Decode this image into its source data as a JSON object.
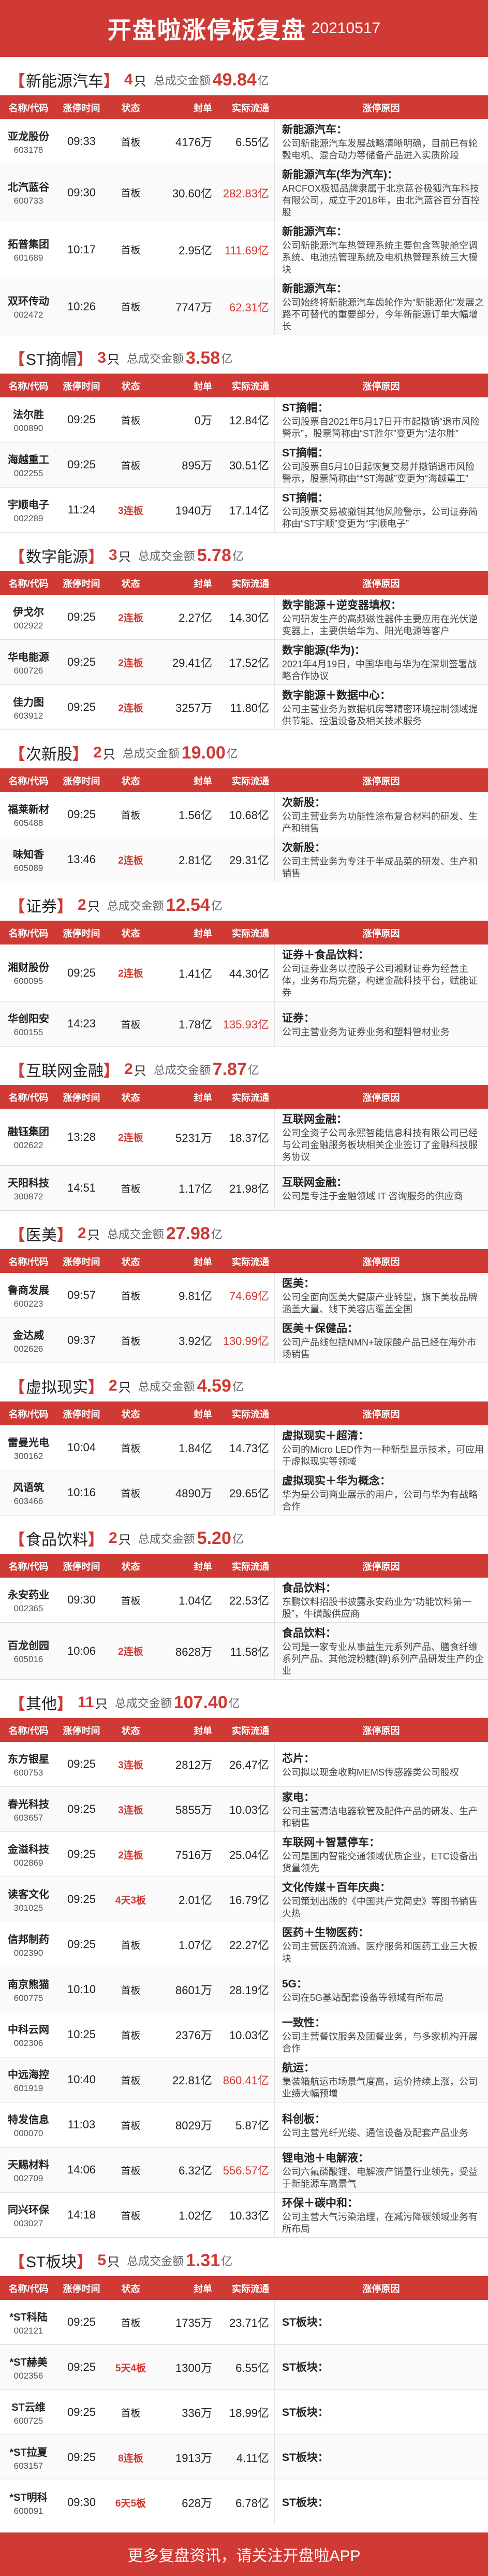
{
  "header": {
    "title": "开盘啦涨停板复盘",
    "date": "20210517"
  },
  "labels": {
    "unit": "只",
    "amount_label": "总成交金额",
    "amount_unit": "亿",
    "cols": [
      "名称/代码",
      "涨停时间",
      "状态",
      "封单",
      "实际流通",
      "涨停原因"
    ]
  },
  "sections": [
    {
      "name": "新能源汽车",
      "count": "4",
      "amount": "49.84",
      "rows": [
        {
          "name": "亚龙股份",
          "code": "603178",
          "time": "09:33",
          "status": "首板",
          "seal": "4176万",
          "turnover": "6.55亿",
          "reason_title": "新能源汽车：",
          "reason_text": "公司新能源汽车发展战略清晰明确，目前已有轮毂电机、混合动力等储备产品进入实质阶段"
        },
        {
          "name": "北汽蓝谷",
          "code": "600733",
          "time": "09:30",
          "status": "首板",
          "seal": "30.60亿",
          "turnover": "282.83亿",
          "reason_title": "新能源汽车(华为汽车)：",
          "reason_text": "ARCFOX极狐品牌隶属于北京蓝谷极狐汽车科技有限公司，成立于2018年，由北汽蓝谷百分百控股"
        },
        {
          "name": "拓普集团",
          "code": "601689",
          "time": "10:17",
          "status": "首板",
          "seal": "2.95亿",
          "turnover": "111.69亿",
          "reason_title": "新能源汽车：",
          "reason_text": "公司新能源汽车热管理系统主要包含驾驶舱空调系统、电池热管理系统及电机热管理系统三大模块"
        },
        {
          "name": "双环传动",
          "code": "002472",
          "time": "10:26",
          "status": "首板",
          "seal": "7747万",
          "turnover": "62.31亿",
          "reason_title": "新能源汽车：",
          "reason_text": "公司始终将新能源汽车齿轮作为“新能源化”发展之路不可替代的重要部分，今年新能源订单大幅增长"
        }
      ]
    },
    {
      "name": "ST摘帽",
      "count": "3",
      "amount": "3.58",
      "rows": [
        {
          "name": "法尔胜",
          "code": "000890",
          "time": "09:25",
          "status": "首板",
          "seal": "0万",
          "turnover": "12.84亿",
          "reason_title": "ST摘帽：",
          "reason_text": "公司股票自2021年5月17日开市起撤销“退市风险警示”，股票简称由“ST胜尔”变更为“法尔胜”"
        },
        {
          "name": "海越重工",
          "code": "002255",
          "time": "09:25",
          "status": "首板",
          "seal": "895万",
          "turnover": "30.51亿",
          "reason_title": "ST摘帽：",
          "reason_text": "公司股票自5月10日起恢复交易并撤销退市风险警示，股票简称由“*ST海越”变更为“海越重工”"
        },
        {
          "name": "宇顺电子",
          "code": "002289",
          "time": "11:24",
          "status": "3连板",
          "seal": "1940万",
          "turnover": "17.14亿",
          "reason_title": "ST摘帽：",
          "reason_text": "公司股票交易被撤销其他风险警示，公司证券简称由“ST宇顺”变更为“宇顺电子”"
        }
      ]
    },
    {
      "name": "数字能源",
      "count": "3",
      "amount": "5.78",
      "rows": [
        {
          "name": "伊戈尔",
          "code": "002922",
          "time": "09:25",
          "status": "2连板",
          "seal": "2.27亿",
          "turnover": "14.30亿",
          "reason_title": "数字能源＋逆变器填权：",
          "reason_text": "公司研发生产的高频磁性器件主要应用在光伏逆变器上，主要供给华为、阳光电源等客户"
        },
        {
          "name": "华电能源",
          "code": "600726",
          "time": "09:25",
          "status": "2连板",
          "seal": "29.41亿",
          "turnover": "17.52亿",
          "reason_title": "数字能源(华为)：",
          "reason_text": "2021年4月19日，中国华电与华为在深圳签署战略合作协议"
        },
        {
          "name": "佳力图",
          "code": "603912",
          "time": "09:25",
          "status": "2连板",
          "seal": "3257万",
          "turnover": "11.80亿",
          "reason_title": "数字能源＋数据中心：",
          "reason_text": "公司主营业务为数据机房等精密环境控制领域提供节能、控温设备及相关技术服务"
        }
      ]
    },
    {
      "name": "次新股",
      "count": "2",
      "amount": "19.00",
      "rows": [
        {
          "name": "福莱新材",
          "code": "605488",
          "time": "09:25",
          "status": "首板",
          "seal": "1.56亿",
          "turnover": "10.68亿",
          "reason_title": "次新股：",
          "reason_text": "公司主营业务为功能性涂布复合材料的研发、生产和销售"
        },
        {
          "name": "味知香",
          "code": "605089",
          "time": "13:46",
          "status": "2连板",
          "seal": "2.81亿",
          "turnover": "29.31亿",
          "reason_title": "次新股：",
          "reason_text": "公司主营业务为专注于半成品菜的研发、生产和销售"
        }
      ]
    },
    {
      "name": "证券",
      "count": "2",
      "amount": "12.54",
      "rows": [
        {
          "name": "湘财股份",
          "code": "600095",
          "time": "09:25",
          "status": "2连板",
          "seal": "1.41亿",
          "turnover": "44.30亿",
          "reason_title": "证券＋食品饮料：",
          "reason_text": "公司证券业务以控股子公司湘财证券为经营主体，业务布局完整，构建金融科技平台，赋能证券"
        },
        {
          "name": "华创阳安",
          "code": "600155",
          "time": "14:23",
          "status": "首板",
          "seal": "1.78亿",
          "turnover": "135.93亿",
          "reason_title": "证券：",
          "reason_text": "公司主营业务为证券业务和塑料管材业务"
        }
      ]
    },
    {
      "name": "互联网金融",
      "count": "2",
      "amount": "7.87",
      "rows": [
        {
          "name": "融钰集团",
          "code": "002622",
          "time": "13:28",
          "status": "2连板",
          "seal": "5231万",
          "turnover": "18.37亿",
          "reason_title": "互联网金融：",
          "reason_text": "公司全资子公司永熙智能信息科技有限公司已经与公司金融服务板块相关企业签订了金融科技服务协议"
        },
        {
          "name": "天阳科技",
          "code": "300872",
          "time": "14:51",
          "status": "首板",
          "seal": "1.17亿",
          "turnover": "21.98亿",
          "reason_title": "互联网金融：",
          "reason_text": "公司是专注于金融领域 IT 咨询服务的供应商"
        }
      ]
    },
    {
      "name": "医美",
      "count": "2",
      "amount": "27.98",
      "rows": [
        {
          "name": "鲁商发展",
          "code": "600223",
          "time": "09:57",
          "status": "首板",
          "seal": "9.81亿",
          "turnover": "74.69亿",
          "reason_title": "医美：",
          "reason_text": "公司全面向医美大健康产业转型，旗下美妆品牌涵盖大量、线下美容店覆盖全国"
        },
        {
          "name": "金达威",
          "code": "002626",
          "time": "09:37",
          "status": "首板",
          "seal": "3.92亿",
          "turnover": "130.99亿",
          "reason_title": "医美＋保健品：",
          "reason_text": "公司产品线包括NMN+玻尿酸产品已经在海外市场销售"
        }
      ]
    },
    {
      "name": "虚拟现实",
      "count": "2",
      "amount": "4.59",
      "rows": [
        {
          "name": "雷曼光电",
          "code": "300162",
          "time": "10:04",
          "status": "首板",
          "seal": "1.84亿",
          "turnover": "14.73亿",
          "reason_title": "虚拟现实＋超清：",
          "reason_text": "公司的Micro LED作为一种新型显示技术，可应用于虚拟现实等领域"
        },
        {
          "name": "风语筑",
          "code": "603466",
          "time": "10:16",
          "status": "首板",
          "seal": "4890万",
          "turnover": "29.65亿",
          "reason_title": "虚拟现实＋华为概念：",
          "reason_text": "华为是公司商业展示的用户，公司与华为有战略合作"
        }
      ]
    },
    {
      "name": "食品饮料",
      "count": "2",
      "amount": "5.20",
      "rows": [
        {
          "name": "永安药业",
          "code": "002365",
          "time": "09:30",
          "status": "首板",
          "seal": "1.04亿",
          "turnover": "22.53亿",
          "reason_title": "食品饮料：",
          "reason_text": "东鹏饮料招股书披露永安药业为“功能饮料第一股”，牛磺酸供应商"
        },
        {
          "name": "百龙创园",
          "code": "605016",
          "time": "10:06",
          "status": "2连板",
          "seal": "8628万",
          "turnover": "11.58亿",
          "reason_title": "食品饮料：",
          "reason_text": "公司是一家专业从事益生元系列产品、膳食纤维系列产品、其他淀粉糖(醇)系列产品研发生产的企业"
        }
      ]
    },
    {
      "name": "其他",
      "count": "11",
      "amount": "107.40",
      "rows": [
        {
          "name": "东方银星",
          "code": "600753",
          "time": "09:25",
          "status": "3连板",
          "seal": "2812万",
          "turnover": "26.47亿",
          "reason_title": "芯片：",
          "reason_text": "公司拟以现金收购MEMS传感器类公司股权"
        },
        {
          "name": "春光科技",
          "code": "603657",
          "time": "09:25",
          "status": "3连板",
          "seal": "5855万",
          "turnover": "10.03亿",
          "reason_title": "家电：",
          "reason_text": "公司主营清洁电器软管及配件产品的研发、生产和销售"
        },
        {
          "name": "金溢科技",
          "code": "002869",
          "time": "09:25",
          "status": "2连板",
          "seal": "7516万",
          "turnover": "25.04亿",
          "reason_title": "车联网＋智慧停车：",
          "reason_text": "公司是国内智能交通领域优质企业，ETC设备出货量领先"
        },
        {
          "name": "读客文化",
          "code": "301025",
          "time": "09:25",
          "status": "4天3板",
          "seal": "2.01亿",
          "turnover": "16.79亿",
          "reason_title": "文化传媒＋百年庆典：",
          "reason_text": "公司策划出版的《中国共产党简史》等图书销售火热"
        },
        {
          "name": "信邦制药",
          "code": "002390",
          "time": "09:25",
          "status": "首板",
          "seal": "1.07亿",
          "turnover": "22.27亿",
          "reason_title": "医药＋生物医药：",
          "reason_text": "公司主营医药流通、医疗服务和医药工业三大板块"
        },
        {
          "name": "南京熊猫",
          "code": "600775",
          "time": "10:10",
          "status": "首板",
          "seal": "8601万",
          "turnover": "28.19亿",
          "reason_title": "5G：",
          "reason_text": "公司在5G基站配套设备等领域有所布局"
        },
        {
          "name": "中科云网",
          "code": "002306",
          "time": "10:25",
          "status": "首板",
          "seal": "2376万",
          "turnover": "10.03亿",
          "reason_title": "一致性：",
          "reason_text": "公司主营餐饮服务及团餐业务，与多家机构开展合作"
        },
        {
          "name": "中远海控",
          "code": "601919",
          "time": "10:40",
          "status": "首板",
          "seal": "22.81亿",
          "turnover": "860.41亿",
          "reason_title": "航运：",
          "reason_text": "集装箱航运市场景气度高，运价持续上涨，公司业绩大幅预增"
        },
        {
          "name": "特发信息",
          "code": "000070",
          "time": "11:03",
          "status": "首板",
          "seal": "8029万",
          "turnover": "5.87亿",
          "reason_title": "科创板：",
          "reason_text": "公司主营光纤光缆、通信设备及配套产品业务"
        },
        {
          "name": "天赐材料",
          "code": "002709",
          "time": "14:06",
          "status": "首板",
          "seal": "6.32亿",
          "turnover": "556.57亿",
          "reason_title": "锂电池＋电解液：",
          "reason_text": "公司六氟磷酸锂、电解液产销量行业领先，受益于新能源车高景气"
        },
        {
          "name": "同兴环保",
          "code": "003027",
          "time": "14:18",
          "status": "首板",
          "seal": "1.02亿",
          "turnover": "10.33亿",
          "reason_title": "环保＋碳中和：",
          "reason_text": "公司主营大气污染治理，在减污降碳领域业务有所布局"
        }
      ]
    },
    {
      "name": "ST板块",
      "count": "5",
      "amount": "1.31",
      "rows": [
        {
          "name": "*ST科陆",
          "code": "002121",
          "time": "09:25",
          "status": "首板",
          "seal": "1735万",
          "turnover": "23.71亿",
          "reason_title": "ST板块：",
          "reason_text": ""
        },
        {
          "name": "*ST赫美",
          "code": "002356",
          "time": "09:25",
          "status": "5天4板",
          "seal": "1300万",
          "turnover": "6.55亿",
          "reason_title": "ST板块：",
          "reason_text": ""
        },
        {
          "name": "ST云维",
          "code": "600725",
          "time": "09:25",
          "status": "首板",
          "seal": "336万",
          "turnover": "18.99亿",
          "reason_title": "ST板块：",
          "reason_text": ""
        },
        {
          "name": "*ST拉夏",
          "code": "603157",
          "time": "09:25",
          "status": "8连板",
          "seal": "1913万",
          "turnover": "4.11亿",
          "reason_title": "ST板块：",
          "reason_text": ""
        },
        {
          "name": "*ST明科",
          "code": "600091",
          "time": "09:30",
          "status": "6天5板",
          "seal": "628万",
          "turnover": "6.78亿",
          "reason_title": "ST板块：",
          "reason_text": ""
        }
      ]
    }
  ],
  "footer": {
    "text": "更多复盘资讯，请关注开盘啦APP"
  }
}
